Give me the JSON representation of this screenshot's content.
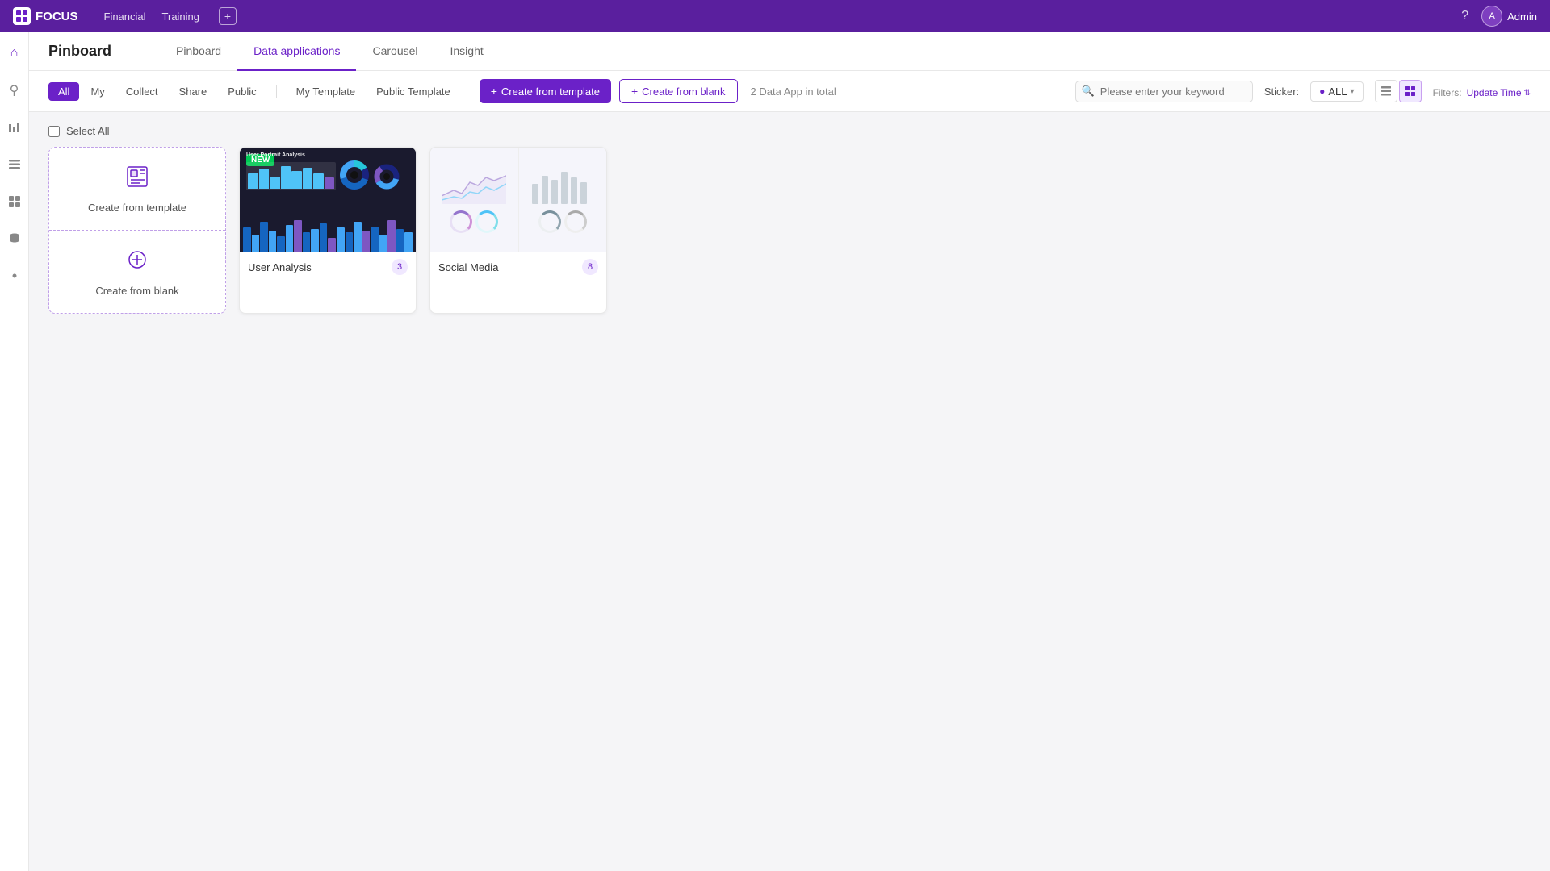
{
  "app": {
    "name": "FOCUS",
    "logo_text": "FOCUS"
  },
  "topnav": {
    "links": [
      "Financial",
      "Training"
    ],
    "plus_icon": "+",
    "help_icon": "?",
    "user": {
      "avatar_text": "A",
      "name": "Admin"
    }
  },
  "sidebar": {
    "icons": [
      {
        "name": "home-icon",
        "symbol": "⌂"
      },
      {
        "name": "search-icon",
        "symbol": "⚲"
      },
      {
        "name": "chart-icon",
        "symbol": "▤"
      },
      {
        "name": "list-icon",
        "symbol": "☰"
      },
      {
        "name": "grid-icon",
        "symbol": "⊞"
      },
      {
        "name": "database-icon",
        "symbol": "▥"
      },
      {
        "name": "settings-icon",
        "symbol": "⚙"
      }
    ]
  },
  "page": {
    "title": "Pinboard",
    "tabs": [
      {
        "id": "pinboard",
        "label": "Pinboard"
      },
      {
        "id": "data-applications",
        "label": "Data applications",
        "active": true
      },
      {
        "id": "carousel",
        "label": "Carousel"
      },
      {
        "id": "insight",
        "label": "Insight"
      }
    ]
  },
  "filter_tabs": [
    {
      "id": "all",
      "label": "All",
      "active": true
    },
    {
      "id": "my",
      "label": "My"
    },
    {
      "id": "collect",
      "label": "Collect"
    },
    {
      "id": "share",
      "label": "Share"
    },
    {
      "id": "public",
      "label": "Public"
    },
    {
      "id": "my-template",
      "label": "My Template"
    },
    {
      "id": "public-template",
      "label": "Public Template"
    }
  ],
  "create_buttons": {
    "template": "Create from template",
    "blank": "Create from blank"
  },
  "count_info": "2 Data App in total",
  "toolbar": {
    "search_placeholder": "Please enter your keyword",
    "sticker_label": "Sticker:",
    "sticker_value": "ALL",
    "filters_label": "Filters:",
    "filter_value": "Update Time"
  },
  "select_all": "Select All",
  "cards": {
    "create_from_template_label": "Create from template",
    "create_from_blank_label": "Create from blank"
  },
  "app_cards": [
    {
      "id": "user-analysis",
      "name": "User Analysis",
      "count": "3",
      "badge": "NEW",
      "has_dark_thumb": true
    },
    {
      "id": "social-media",
      "name": "Social Media",
      "count": "8",
      "badge": null,
      "has_dark_thumb": false
    }
  ]
}
